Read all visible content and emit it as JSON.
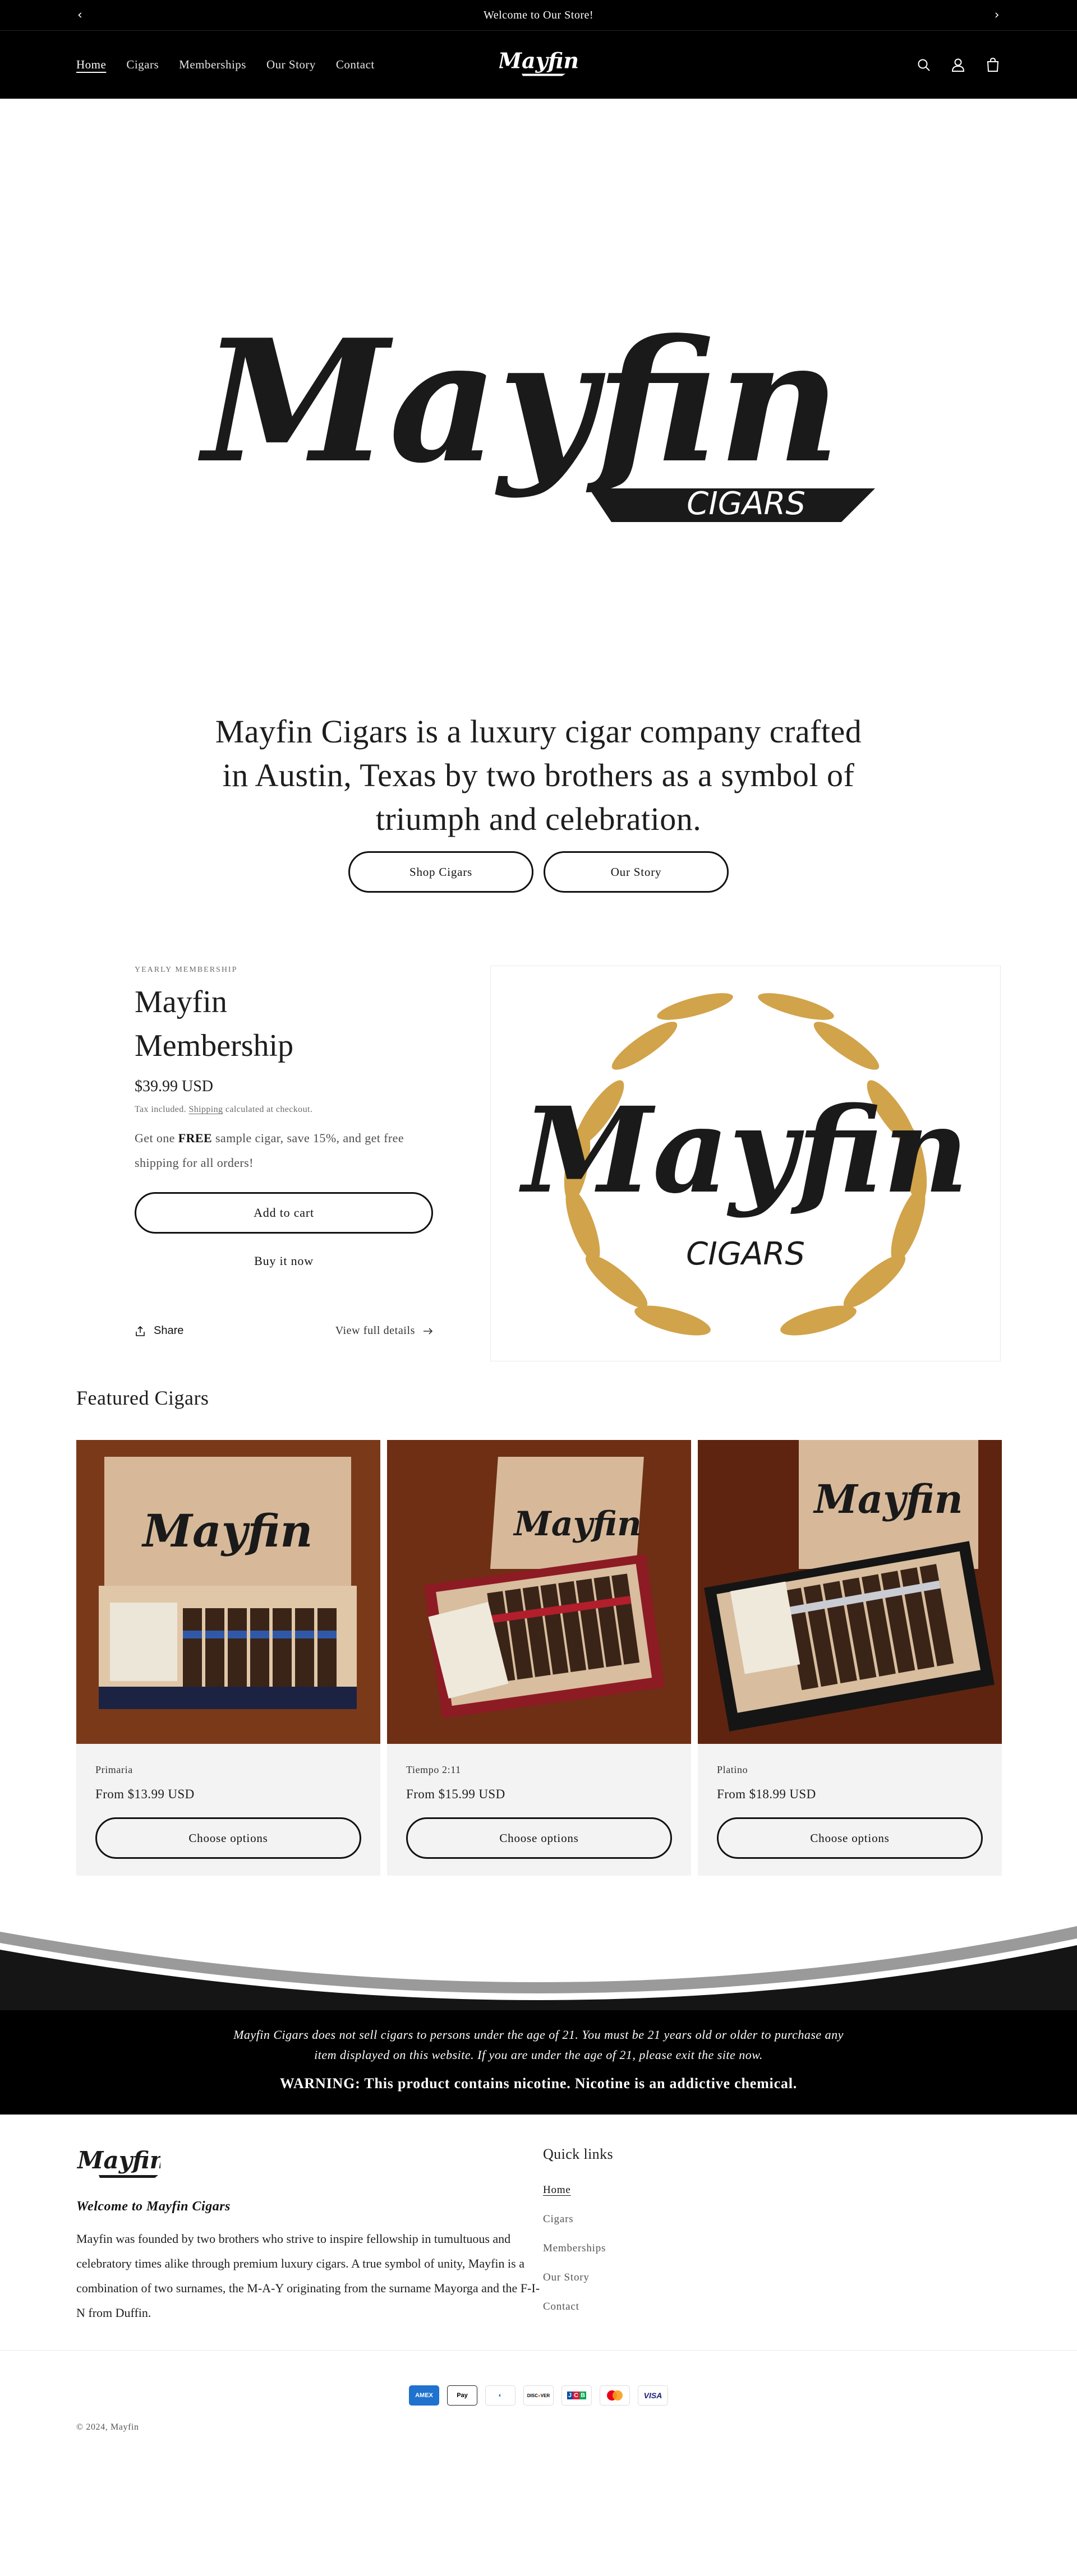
{
  "announcement": {
    "text": "Welcome to Our Store!",
    "prev_icon": "chevron-left-icon",
    "next_icon": "chevron-right-icon"
  },
  "header": {
    "nav": [
      {
        "label": "Home",
        "active": true
      },
      {
        "label": "Cigars",
        "active": false
      },
      {
        "label": "Memberships",
        "active": false
      },
      {
        "label": "Our Story",
        "active": false
      },
      {
        "label": "Contact",
        "active": false
      }
    ],
    "logo_text": "Mayfin",
    "icons": [
      "search-icon",
      "account-icon",
      "cart-icon"
    ]
  },
  "hero": {
    "logo_word": "Mayfin",
    "logo_sub": "CIGARS"
  },
  "intro": {
    "heading": "Mayfin Cigars is a luxury cigar company crafted in Austin, Texas by two brothers as a symbol of triumph and celebration.",
    "buttons": [
      "Shop Cigars",
      "Our Story"
    ]
  },
  "membership": {
    "eyebrow": "YEARLY MEMBERSHIP",
    "title_line1": "Mayfin",
    "title_line2": "Membership",
    "price": "$39.99 USD",
    "tax_prefix": "Tax included.",
    "tax_link": "Shipping",
    "tax_suffix": "calculated at checkout.",
    "desc_before": "Get one",
    "desc_bold": "FREE",
    "desc_after": "sample cigar, save 15%, and get free shipping for all orders!",
    "add_to_cart": "Add to cart",
    "buy_now": "Buy it now",
    "share": "Share",
    "view_details": "View full details",
    "image_word": "Mayfin",
    "image_sub": "CIGARS",
    "wreath_color": "#d1a34a"
  },
  "featured": {
    "heading": "Featured Cigars",
    "products": [
      {
        "name": "Primaria",
        "price": "From $13.99 USD",
        "button": "Choose options",
        "band": "#2f59a8",
        "box_edge": "#1c2342"
      },
      {
        "name": "Tiempo 2:11",
        "price": "From $15.99 USD",
        "button": "Choose options",
        "band": "#b21e2b",
        "box_edge": "#8d1b24"
      },
      {
        "name": "Platino",
        "price": "From $18.99 USD",
        "button": "Choose options",
        "band": "#c9ccd3",
        "box_edge": "#151515"
      }
    ]
  },
  "warning": {
    "text": "Mayfin Cigars does not sell cigars to persons under the age of 21.  You must be 21 years old or older to purchase any item displayed on this website. If you are under the age of 21, please exit the site now.",
    "bold": "WARNING: This product contains nicotine. Nicotine is an addictive chemical."
  },
  "footer": {
    "logo_text": "Mayfin",
    "welcome": "Welcome to Mayfin Cigars",
    "about": "Mayfin was founded by two brothers who strive to inspire fellowship in tumultuous and celebratory times alike through premium luxury cigars. A true symbol of unity, Mayfin is a combination of two surnames, the M-A-Y originating from the surname Mayorga and the F-I-N from Duffin.",
    "quick_links_title": "Quick links",
    "quick_links": [
      {
        "label": "Home",
        "active": true
      },
      {
        "label": "Cigars",
        "active": false
      },
      {
        "label": "Memberships",
        "active": false
      },
      {
        "label": "Our Story",
        "active": false
      },
      {
        "label": "Contact",
        "active": false
      }
    ],
    "payment_icons": [
      "amex-icon",
      "apple-pay-icon",
      "diners-club-icon",
      "discover-icon",
      "jcb-icon",
      "mastercard-icon",
      "visa-icon"
    ],
    "copyright": "© 2024, Mayfin"
  }
}
